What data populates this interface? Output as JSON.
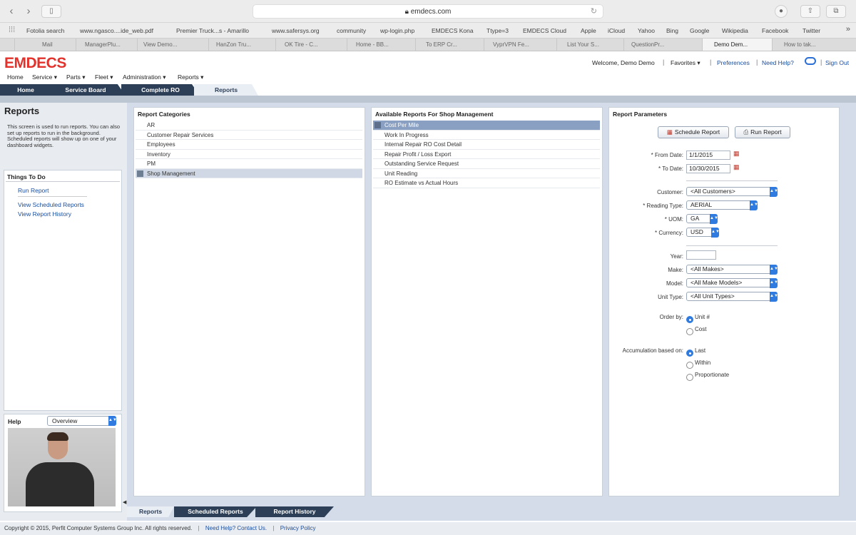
{
  "browser": {
    "address": "emdecs.com",
    "bookmarks": [
      "Fotolia search",
      "www.ngasco....ide_web.pdf",
      "Premier Truck...s - Amarillo",
      "www.safersys.org",
      "community",
      "wp-login.php",
      "EMDECS Kona",
      "Ttype=3",
      "EMDECS Cloud",
      "Apple",
      "iCloud",
      "Yahoo",
      "Bing",
      "Google",
      "Wikipedia",
      "Facebook",
      "Twitter"
    ],
    "tabs": [
      "Mail",
      "ManagerPlu...",
      "View Demo...",
      "HanZon Tru...",
      "OK Tire - C...",
      "Home - BB...",
      "To ERP Cr...",
      "VyprVPN Fe...",
      "List Your S...",
      "QuestionPr...",
      "Demo Dem...",
      "How to tak..."
    ]
  },
  "app": {
    "logo": "EMDECS",
    "menu": [
      "Home",
      "Service ▾",
      "Parts ▾",
      "Fleet ▾",
      "Administration ▾",
      "Reports ▾"
    ],
    "welcome": "Welcome, Demo Demo",
    "favorites": "Favorites ▾",
    "preferences": "Preferences",
    "need_help": "Need Help?",
    "sign_out": "Sign Out",
    "main_tabs": [
      "Home",
      "Service Board",
      "Complete RO",
      "Reports"
    ]
  },
  "left": {
    "title": "Reports",
    "description": "This screen is used to run reports. You can also set up reports to run in the background. Scheduled reports will show up on one of your dashboard widgets.",
    "things_title": "Things To Do",
    "things": [
      "Run Report",
      "View Scheduled Reports",
      "View Report History"
    ],
    "help_title": "Help",
    "help_select": "Overview"
  },
  "categories": {
    "title": "Report Categories",
    "items": [
      "AR",
      "Customer Repair Services",
      "Employees",
      "Inventory",
      "PM",
      "Shop Management"
    ]
  },
  "available": {
    "title": "Available Reports For Shop Management",
    "items": [
      "Cost Per Mile",
      "Work In Progress",
      "Internal Repair RO Cost Detail",
      "Repair Profit / Loss Export",
      "Outstanding Service Request",
      "Unit Reading",
      "RO Estimate vs Actual Hours"
    ]
  },
  "params": {
    "title": "Report Parameters",
    "schedule_btn": "Schedule Report",
    "run_btn": "Run Report",
    "from_label": "* From Date:",
    "from_value": "1/1/2015",
    "to_label": "* To Date:",
    "to_value": "10/30/2015",
    "customer_label": "Customer:",
    "customer_value": "<All Customers>",
    "reading_label": "* Reading Type:",
    "reading_value": "AERIAL",
    "uom_label": "* UOM:",
    "uom_value": "GA",
    "currency_label": "* Currency:",
    "currency_value": "USD",
    "year_label": "Year:",
    "make_label": "Make:",
    "make_value": "<All Makes>",
    "model_label": "Model:",
    "model_value": "<All Make Models>",
    "unittype_label": "Unit Type:",
    "unittype_value": "<All Unit Types>",
    "order_label": "Order by:",
    "order_options": [
      "Unit #",
      "Cost"
    ],
    "accum_label": "Accumulation based on:",
    "accum_options": [
      "Last",
      "Within",
      "Proportionate"
    ]
  },
  "bottom_tabs": [
    "Reports",
    "Scheduled Reports",
    "Report History"
  ],
  "footer": {
    "copyright": "Copyright © 2015, Perfit Computer Systems Group Inc. All rights reserved.",
    "help_link": "Need Help? Contact Us.",
    "privacy": "Privacy Policy"
  }
}
